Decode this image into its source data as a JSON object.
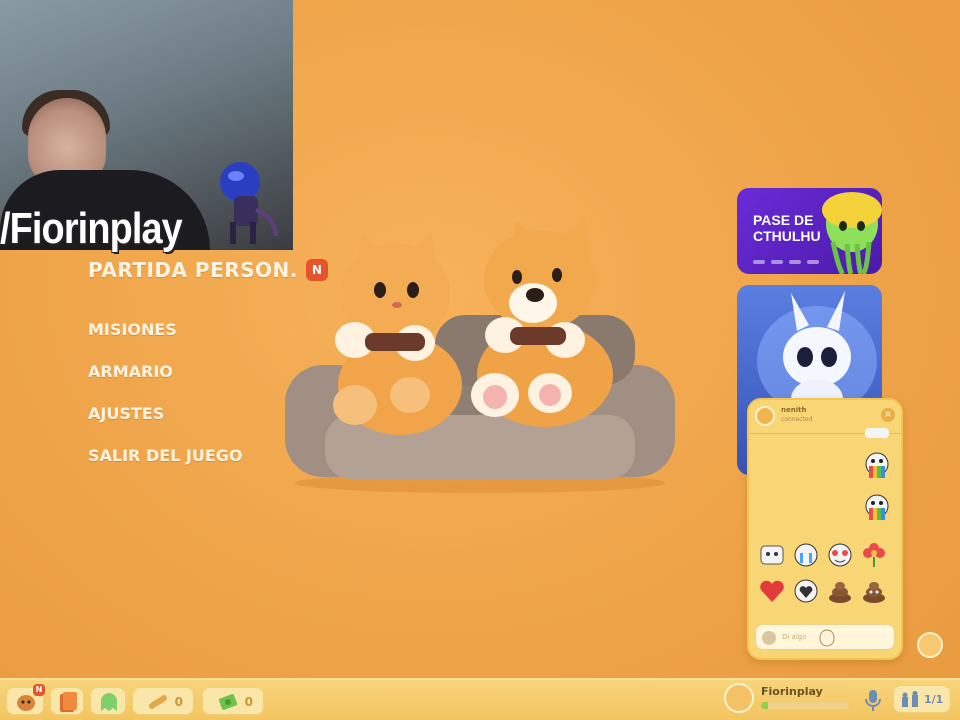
{
  "stream_overlay": {
    "channel_name": "/Fiorinplay"
  },
  "menu": {
    "primary_label": "PARTIDA PERSON.",
    "primary_badge": "N",
    "items": [
      {
        "label": "MISIONES"
      },
      {
        "label": "ARMARIO"
      },
      {
        "label": "AJUSTES"
      },
      {
        "label": "SALIR DEL JUEGO"
      }
    ]
  },
  "promo": {
    "pass_title_line1": "PASE DE",
    "pass_title_line2": "CTHULHU"
  },
  "chat": {
    "username": "nenith",
    "status": "connected",
    "close_label": "×",
    "input_placeholder": "Di algo"
  },
  "bottombar": {
    "notification_badge": "N",
    "bones_count": "0",
    "cash_count": "0",
    "profile_name": "Fiorinplay",
    "xp_progress": 0.08,
    "party_count": "1/1"
  },
  "colors": {
    "background": "#f0a64c",
    "menu_text": "#fff4e2",
    "badge": "#e4542d",
    "chat_panel": "#f8d676",
    "pass_card": "#6a2bd8"
  },
  "icons": {
    "menu_badge": "new-badge-icon",
    "chat_close": "close-icon",
    "chat_emote": "emoji-icon",
    "bottombar_left": [
      "pet-icon",
      "cards-icon",
      "ghost-icon",
      "bone-icon",
      "cash-icon"
    ],
    "bottombar_right": [
      "microphone-icon",
      "party-icon"
    ]
  }
}
